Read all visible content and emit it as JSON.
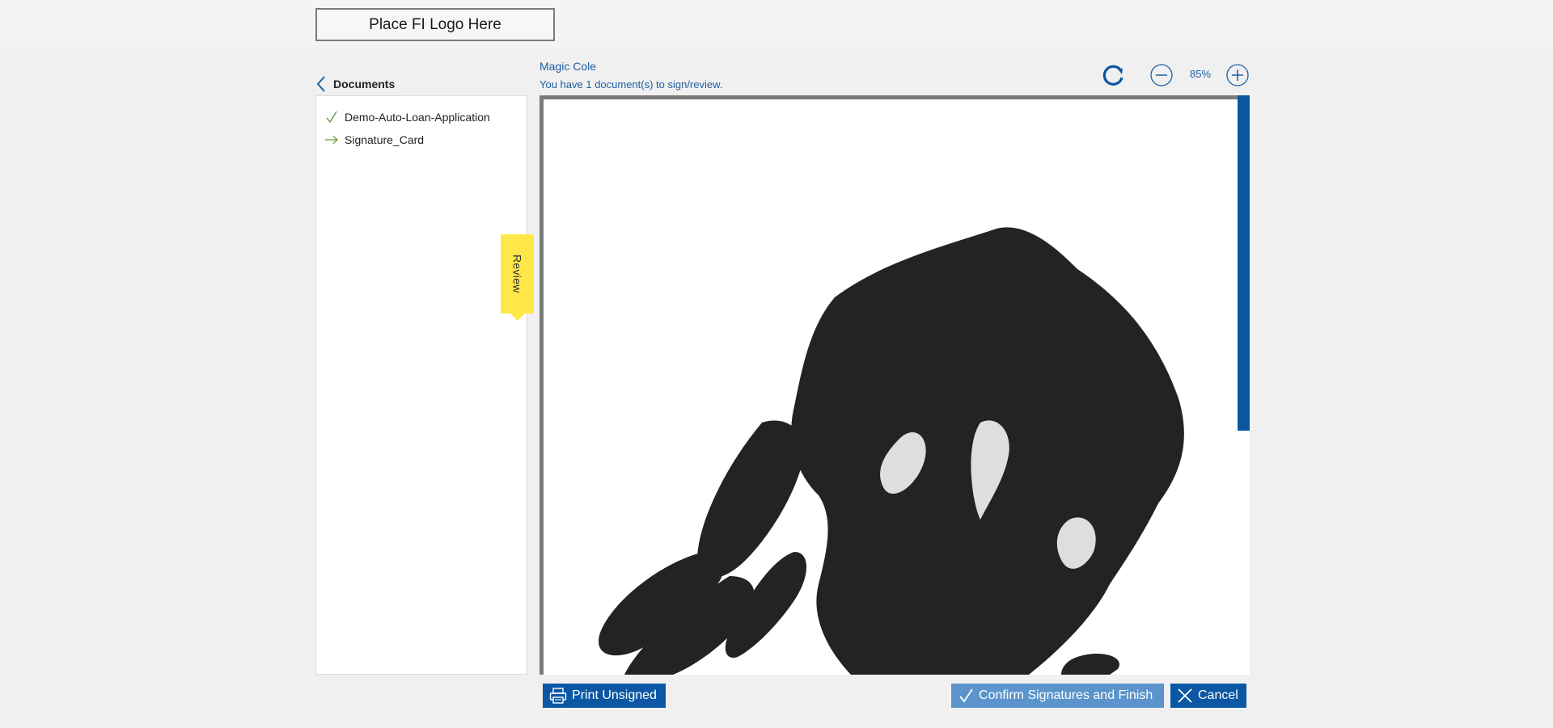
{
  "header": {
    "logo_placeholder": "Place FI Logo Here"
  },
  "sidebar": {
    "title": "Documents",
    "items": [
      {
        "label": "Demo-Auto-Loan-Application",
        "status_icon": "checkmark-icon",
        "status_color": "#6a9a3a"
      },
      {
        "label": "Signature_Card",
        "status_icon": "arrow-right-icon",
        "status_color": "#6a9a3a"
      }
    ],
    "review_tab_label": "Review"
  },
  "viewer_header": {
    "user_name": "Magic Cole",
    "doc_count_text": "You have 1 document(s) to sign/review.",
    "zoom_level": "85%"
  },
  "footer": {
    "print_label": "Print Unsigned",
    "confirm_label": "Confirm Signatures and Finish",
    "cancel_label": "Cancel"
  },
  "colors": {
    "accent": "#0b57a4",
    "accent_light": "#5b94cc",
    "link_text": "#1f5fa0",
    "review_tab": "#ffe74a"
  }
}
